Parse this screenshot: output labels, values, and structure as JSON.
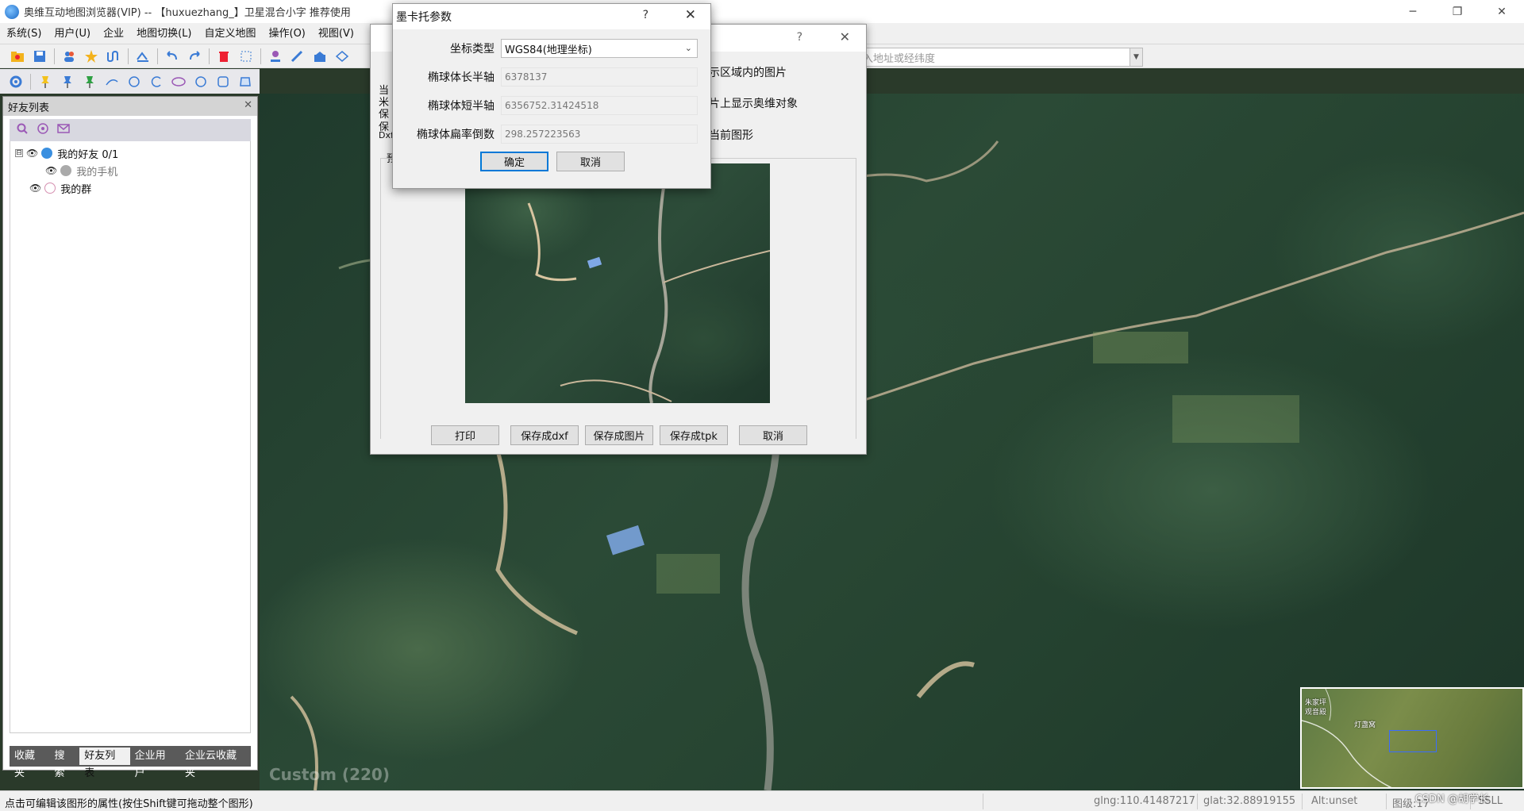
{
  "window": {
    "title": "奥维互动地图浏览器(VIP) -- 【huxuezhang_】卫星混合小字 推荐使用",
    "minimize": "─",
    "maximize": "❐",
    "close": "✕"
  },
  "menu": [
    "系统(S)",
    "用户(U)",
    "企业",
    "地图切换(L)",
    "自定义地图",
    "操作(O)",
    "视图(V)"
  ],
  "address_bar": {
    "placeholder": "入地址或经纬度"
  },
  "left_panel": {
    "title": "好友列表",
    "tree": [
      {
        "label": "我的好友 0/1",
        "expanded": "⊟"
      },
      {
        "label": "我的手机"
      },
      {
        "label": "我的群"
      }
    ],
    "tabs": [
      "收藏夹",
      "搜索",
      "好友列表",
      "企业用户",
      "企业云收藏夹"
    ],
    "active_tab": "好友列表"
  },
  "print_dialog": {
    "help": "?",
    "close": "✕",
    "left_texts": [
      "当",
      "米",
      "保",
      "保",
      "Dxf",
      "预"
    ],
    "options": [
      "示区域内的图片",
      "片上显示奥维对象",
      "当前图形"
    ],
    "buttons": [
      "打印",
      "保存成dxf",
      "保存成图片",
      "保存成tpk",
      "取消"
    ]
  },
  "mercator_dialog": {
    "title": "墨卡托参数",
    "help": "?",
    "close": "✕",
    "fields": [
      {
        "label": "坐标类型",
        "value": "WGS84(地理坐标)"
      },
      {
        "label": "椭球体长半轴",
        "value": "6378137"
      },
      {
        "label": "椭球体短半轴",
        "value": "6356752.31424518"
      },
      {
        "label": "椭球体扁率倒数",
        "value": "298.257223563"
      }
    ],
    "ok": "确定",
    "cancel": "取消"
  },
  "map": {
    "watermark": "Custom (220)",
    "minimap_labels": [
      "朱家坪",
      "观音殿",
      "灯盏窝"
    ]
  },
  "status": {
    "hint": "点击可编辑该图形的属性(按住Shift键可拖动整个图形)",
    "glng": "glng:110.41487217",
    "glat": "glat:32.88919155",
    "alt": "Alt:unset",
    "level": "图级:17",
    "sheet": "SSLL"
  },
  "watermark_csdn": "CSDN @胡学长"
}
